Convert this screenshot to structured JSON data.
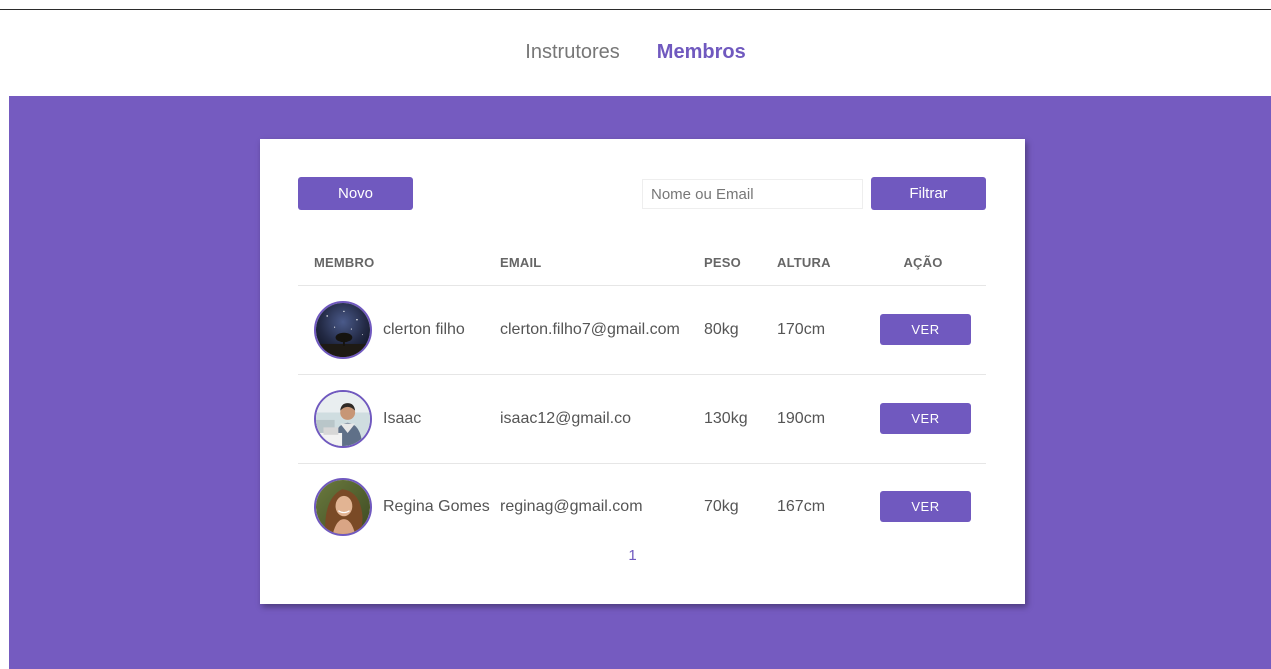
{
  "nav": {
    "items": [
      {
        "label": "Instrutores",
        "active": false
      },
      {
        "label": "Membros",
        "active": true
      }
    ]
  },
  "toolbar": {
    "new_label": "Novo",
    "search_placeholder": "Nome ou Email",
    "search_value": "",
    "filter_label": "Filtrar"
  },
  "table": {
    "headers": {
      "member": "MEMBRO",
      "email": "EMAIL",
      "weight": "PESO",
      "height": "ALTURA",
      "action": "AÇÃO"
    },
    "rows": [
      {
        "name": "clerton filho",
        "email": "clerton.filho7@gmail.com",
        "weight": "80kg",
        "height": "170cm",
        "action_label": "VER",
        "avatar": "night-sky-tree-photo"
      },
      {
        "name": "Isaac",
        "email": "isaac12@gmail.co",
        "weight": "130kg",
        "height": "190cm",
        "action_label": "VER",
        "avatar": "man-laptop-photo"
      },
      {
        "name": "Regina Gomes",
        "email": "reginag@gmail.com",
        "weight": "70kg",
        "height": "167cm",
        "action_label": "VER",
        "avatar": "woman-portrait-photo"
      }
    ]
  },
  "pagination": {
    "current_page": "1"
  },
  "colors": {
    "accent": "#7059bf",
    "background_band": "#755bc0",
    "text": "#555555"
  }
}
